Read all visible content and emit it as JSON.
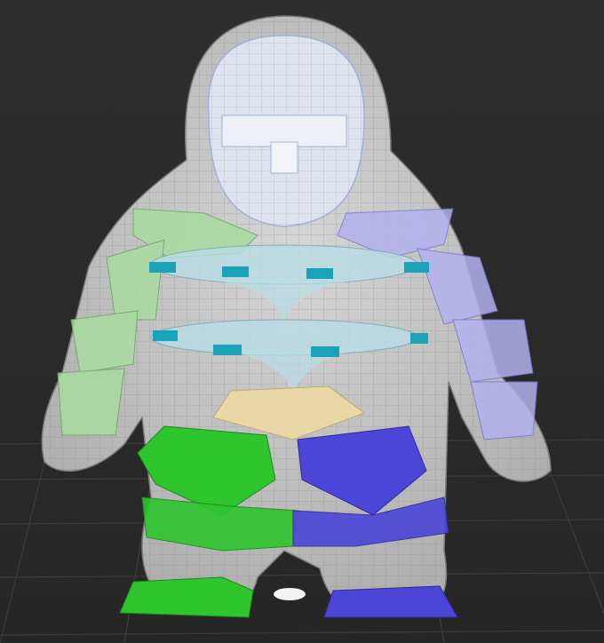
{
  "viewport": {
    "colors": {
      "background_top": "#2e2e2e",
      "background_bottom": "#262626",
      "grid": "#3c3c3c",
      "body": "#c8c8c8",
      "wire": "#8a8a8a",
      "head_selected": "#dfe3ee",
      "left_limb": "#2ec52e",
      "left_limb_light": "#a9dca0",
      "right_limb": "#4b46d8",
      "right_limb_light": "#b4b2ee",
      "spine_disk": "#b9dde6",
      "spine_bone": "#1aa3b8",
      "pelvis": "#ead7a8"
    }
  }
}
